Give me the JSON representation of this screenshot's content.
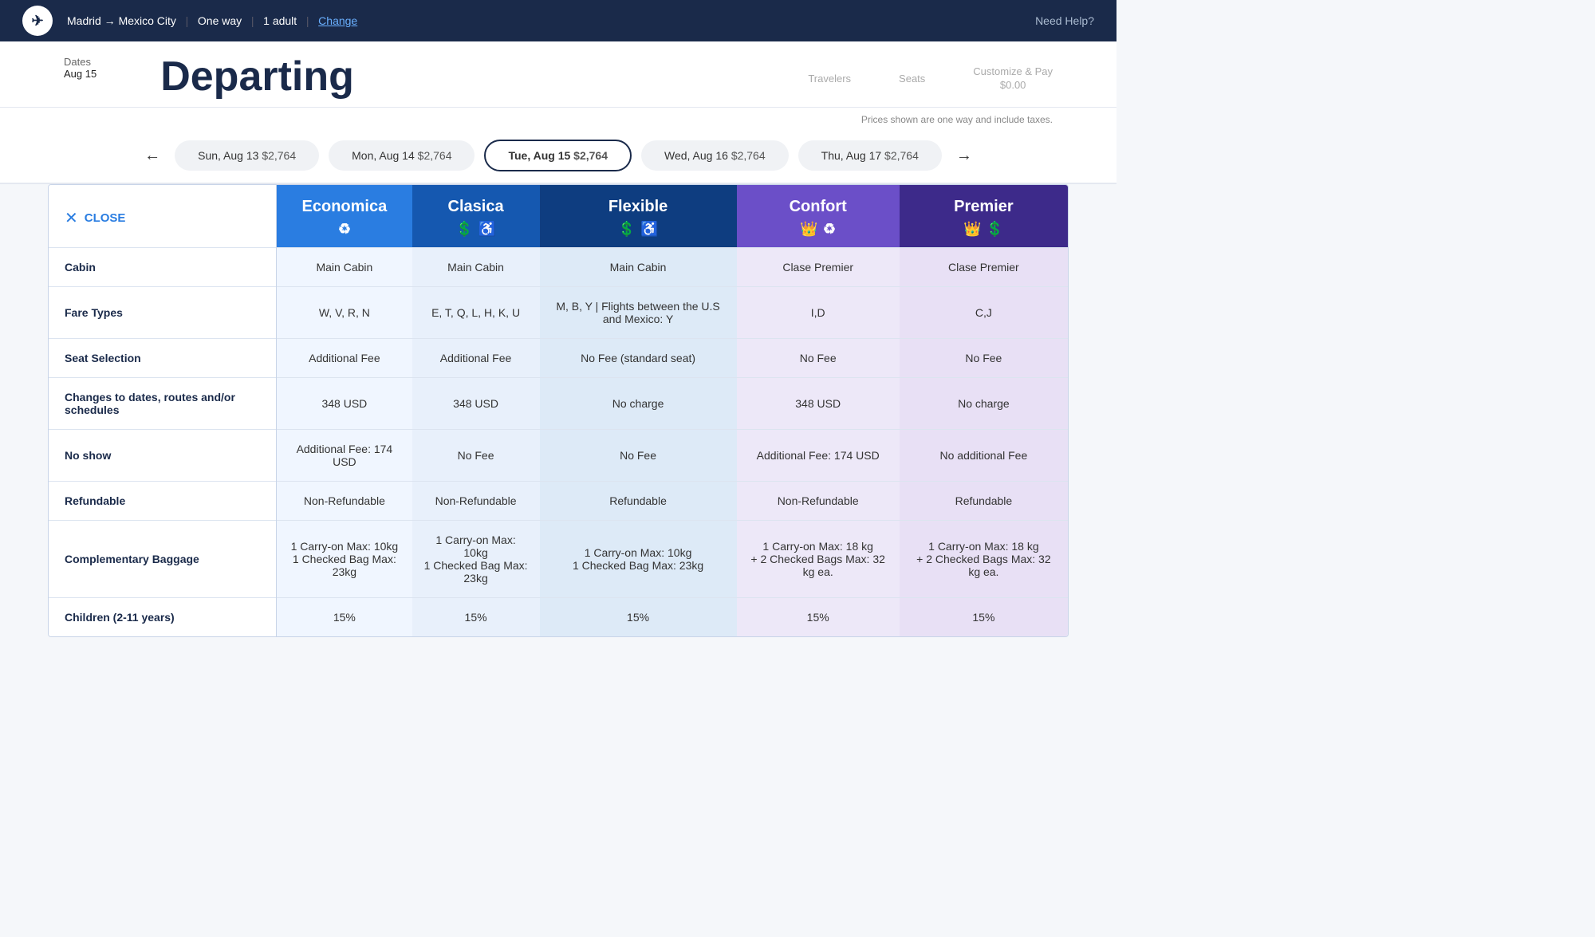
{
  "topNav": {
    "logo": "✈",
    "route": "Madrid → Mexico City",
    "tripType": "One way",
    "passengers": "1 adult",
    "changeLabel": "Change",
    "helpLabel": "Need Help?"
  },
  "stepBar": {
    "dateLabel": "Dates",
    "dateValue": "Aug 15",
    "title": "Departing",
    "steps": [
      {
        "label": "Travelers",
        "sub": ""
      },
      {
        "label": "Seats",
        "sub": ""
      },
      {
        "label": "Customize & Pay",
        "sub": "$0.00"
      }
    ]
  },
  "priceNote": "Prices shown are one way and include taxes.",
  "datePills": [
    {
      "label": "Sun, Aug 13",
      "price": "$2,764"
    },
    {
      "label": "Mon, Aug 14",
      "price": "$2,764"
    },
    {
      "label": "Tue, Aug 15",
      "price": "$2,764",
      "selected": true
    },
    {
      "label": "Wed, Aug 16",
      "price": "$2,764"
    },
    {
      "label": "Thu, Aug 17",
      "price": "$2,764"
    }
  ],
  "table": {
    "closeLabel": "CLOSE",
    "headers": [
      {
        "key": "label",
        "text": ""
      },
      {
        "key": "economica",
        "text": "Economica",
        "icons": [
          "recycle-icon"
        ],
        "class": "th-economica"
      },
      {
        "key": "clasica",
        "text": "Clasica",
        "icons": [
          "dollar-icon",
          "wheelchair-icon"
        ],
        "class": "th-clasica"
      },
      {
        "key": "flexible",
        "text": "Flexible",
        "icons": [
          "dollar-icon",
          "wheelchair-icon"
        ],
        "class": "th-flexible"
      },
      {
        "key": "confort",
        "text": "Confort",
        "icons": [
          "crown",
          "recycle-icon"
        ],
        "class": "th-confort",
        "hasCrown": true
      },
      {
        "key": "premier",
        "text": "Premier",
        "icons": [
          "crown",
          "dollar-icon"
        ],
        "class": "th-premier",
        "hasCrown": true
      }
    ],
    "rows": [
      {
        "label": "Cabin",
        "economica": "Main Cabin",
        "clasica": "Main Cabin",
        "flexible": "Main Cabin",
        "confort": "Clase Premier",
        "premier": "Clase Premier"
      },
      {
        "label": "Fare Types",
        "economica": "W, V, R, N",
        "clasica": "E, T, Q, L, H, K, U",
        "flexible": "M, B, Y | Flights between the U.S and Mexico: Y",
        "confort": "I,D",
        "premier": "C,J"
      },
      {
        "label": "Seat Selection",
        "economica": "Additional Fee",
        "clasica": "Additional Fee",
        "flexible": "No Fee (standard seat)",
        "confort": "No Fee",
        "premier": "No Fee"
      },
      {
        "label": "Changes to dates, routes and/or schedules",
        "economica": "348 USD",
        "clasica": "348 USD",
        "flexible": "No charge",
        "confort": "348 USD",
        "premier": "No charge"
      },
      {
        "label": "No show",
        "economica": "Additional Fee: 174 USD",
        "clasica": "No Fee",
        "flexible": "No Fee",
        "confort": "Additional Fee: 174 USD",
        "premier": "No additional Fee"
      },
      {
        "label": "Refundable",
        "economica": "Non-Refundable",
        "clasica": "Non-Refundable",
        "flexible": "Refundable",
        "confort": "Non-Refundable",
        "premier": "Refundable"
      },
      {
        "label": "Complementary Baggage",
        "economica": "1 Carry-on Max: 10kg\n1 Checked Bag Max: 23kg",
        "clasica": "1 Carry-on Max: 10kg\n1 Checked Bag Max: 23kg",
        "flexible": "1 Carry-on Max: 10kg\n1 Checked Bag Max: 23kg",
        "confort": "1 Carry-on Max: 18 kg\n+ 2 Checked Bags Max: 32 kg ea.",
        "premier": "1 Carry-on Max: 18 kg\n+ 2 Checked Bags Max: 32 kg ea."
      },
      {
        "label": "Children (2-11 years)",
        "economica": "15%",
        "clasica": "15%",
        "flexible": "15%",
        "confort": "15%",
        "premier": "15%"
      }
    ]
  }
}
